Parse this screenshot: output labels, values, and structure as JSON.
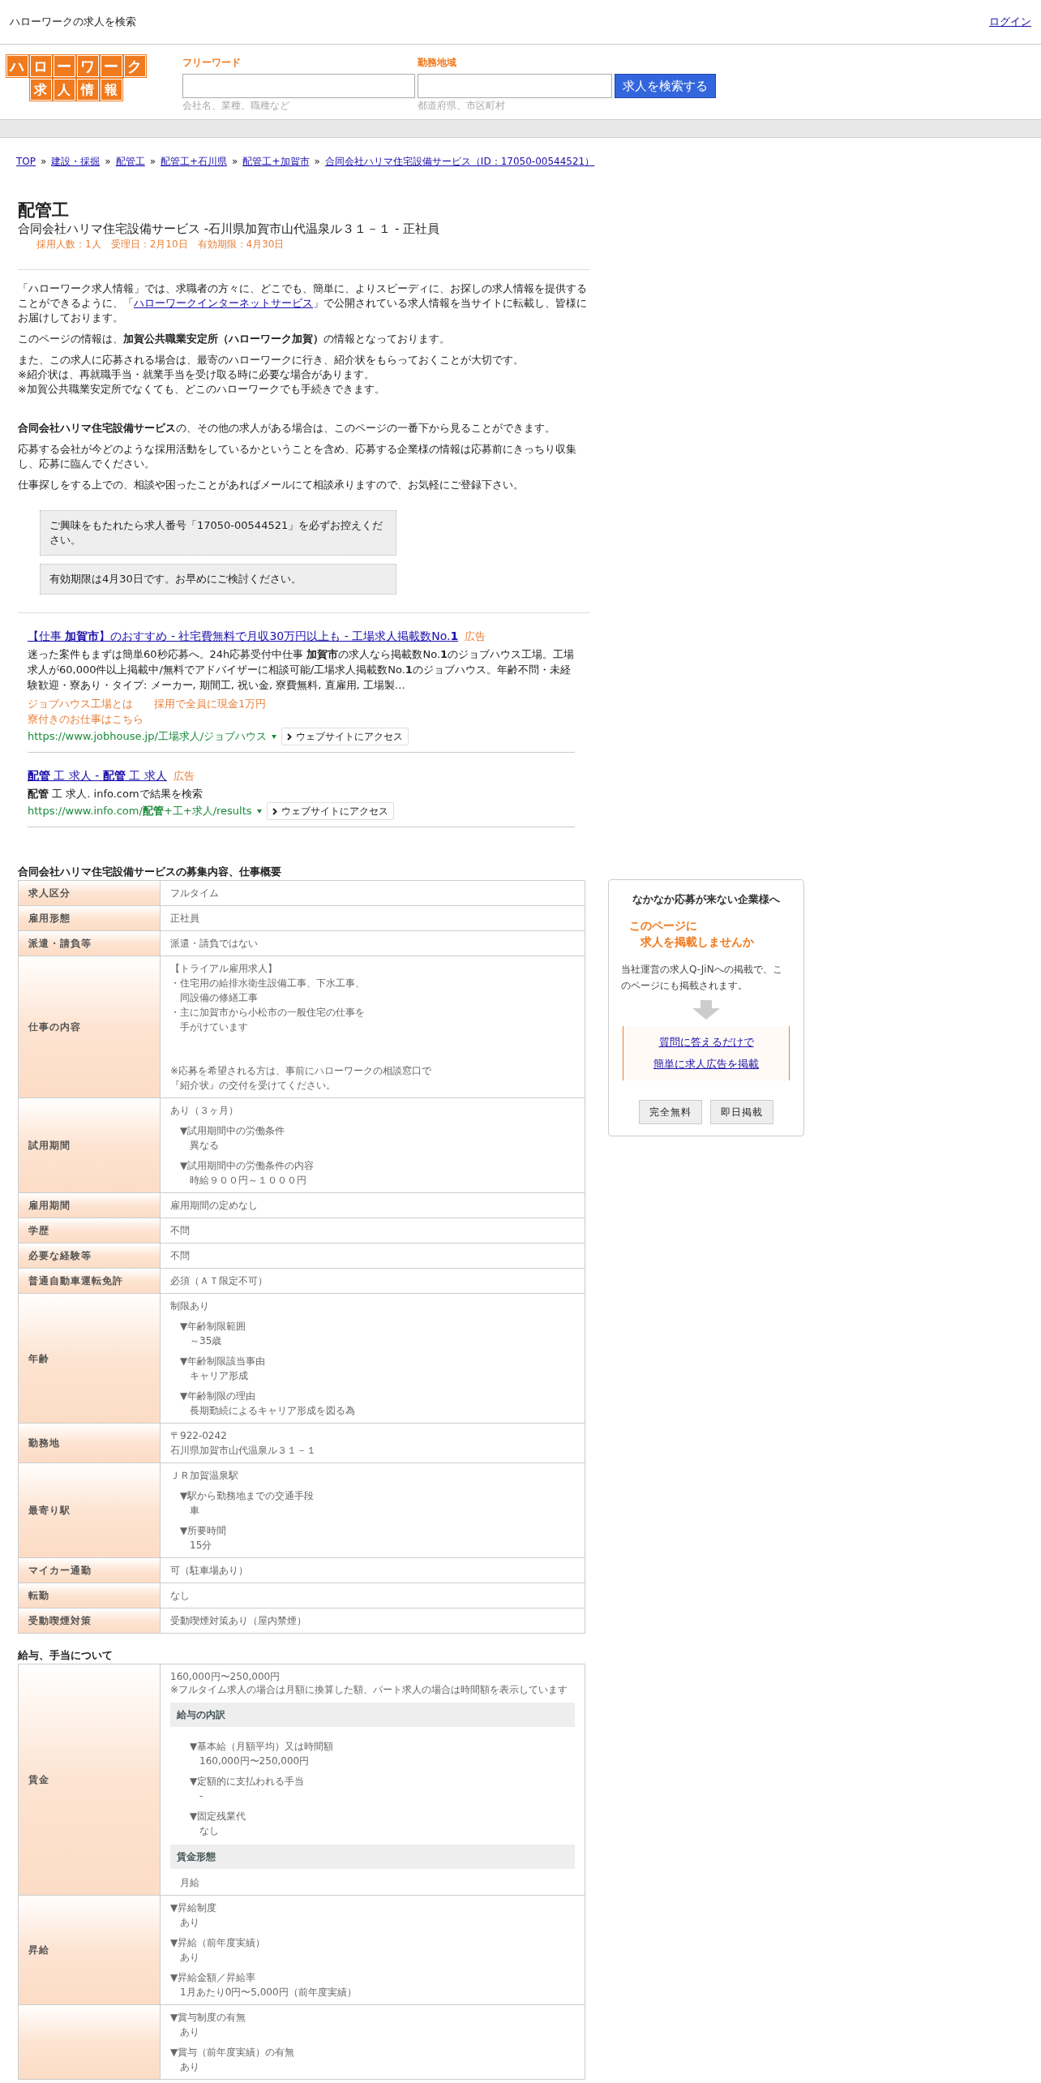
{
  "top_bar": {
    "title": "ハローワークの求人を検索",
    "login": "ログイン"
  },
  "logo": {
    "row_1": [
      "ハ",
      "ロ",
      "ー",
      "ワ",
      "ー",
      "ク"
    ],
    "row_2": [
      "求",
      "人",
      "情",
      "報"
    ]
  },
  "search": {
    "fields": [
      {
        "label": "フリーワード",
        "hint": "会社名、業種、職種など"
      },
      {
        "label": "勤務地域",
        "hint": "都道府県、市区町村"
      }
    ],
    "button": "求人を検索する"
  },
  "breadcrumb_separator": "»",
  "breadcrumb": [
    "TOP",
    "建設・採掘",
    "配管工",
    "配管工+石川県",
    "配管工+加賀市",
    "合同会社ハリマ住宅設備サービス（ID：17050-00544521）"
  ],
  "job": {
    "title": "配管工",
    "subtitle": "合同会社ハリマ住宅設備サービス -石川県加賀市山代温泉ル３１－１ - 正社員",
    "meta": "採用人数：1人　受理日：2月10日　有効期限：4月30日"
  },
  "intro": {
    "lead_before": "「ハローワーク求人情報」では、求職者の方々に、どこでも、簡単に、よりスピーディに、お探しの求人情報を提供することができるように、「",
    "lead_link": "ハローワークインターネットサービス",
    "lead_after": "」で公開されている求人情報を当サイトに転載し、皆様にお届けしております。",
    "paragraphs": [
      [
        "このページの情報は、**加賀公共職業安定所（ハローワーク加賀）**の情報となっております。"
      ],
      [
        "また、この求人に応募される場合は、最寄のハローワークに行き、紹介状をもらっておくことが大切です。",
        "※紹介状は、再就職手当・就業手当を受け取る時に必要な場合があります。",
        "※加賀公共職業安定所でなくても、どこのハローワークでも手続きできます。"
      ]
    ],
    "paragraphs_2": [
      [
        "**合同会社ハリマ住宅設備サービス**の、その他の求人がある場合は、このページの一番下から見ることができます。"
      ],
      [
        "応募する会社が今どのような採用活動をしているかということを含め、応募する企業様の情報は応募前にきっちり収集し、応募に臨んでください。"
      ],
      [
        "仕事探しをする上での、相談や困ったことがあればメールにて相談承りますので、お気軽にご登録下さい。"
      ]
    ]
  },
  "notices": [
    "ご興味をもたれたら求人番号「17050-00544521」を必ずお控えください。",
    "有効期限は4月30日です。お早めにご検討ください。"
  ],
  "ads": [
    {
      "title": "【仕事 **加賀市**】のおすすめ - 社宅費無料で月収30万円以上も - 工場求人掲載数No.**1**",
      "label": "広告",
      "description": "迷った案件もまずは簡単60秒応募へ。24h応募受付中仕事 **加賀市**の求人なら掲載数No.**1**のジョブハウス工場。工場求人が60,000件以上掲載中/無料でアドバイザーに相談可能/工場求人掲載数No.**1**のジョブハウス。年齢不問・未経験歓迎・寮あり・タイプ: メーカー, 期間工, 祝い金, 寮費無料, 直雇用, 工場製…",
      "sitelinks": [
        "ジョブハウス工場とは",
        "採用で全員に現金1万円",
        "寮付きのお仕事はこちら"
      ],
      "url": "https://www.jobhouse.jp/工場求人/ジョブハウス",
      "button": "ウェブサイトにアクセス"
    },
    {
      "title": "**配管** 工 求人 - **配管** 工 求人",
      "label": "広告",
      "description": "**配管** 工 求人. info.comで結果を検索",
      "url": "https://www.info.com/**配管**+工+求人/results",
      "button": "ウェブサイトにアクセス"
    }
  ],
  "sections": [
    {
      "title": "合同会社ハリマ住宅設備サービスの募集内容、仕事概要",
      "rows": [
        {
          "label": "求人区分",
          "content": [
            {
              "kind": "line",
              "text": "フルタイム"
            }
          ]
        },
        {
          "label": "雇用形態",
          "content": [
            {
              "kind": "line",
              "text": "正社員"
            }
          ]
        },
        {
          "label": "派遣・請負等",
          "content": [
            {
              "kind": "line",
              "text": "派遣・請負ではない"
            }
          ]
        },
        {
          "label": "仕事の内容",
          "content": [
            {
              "kind": "line",
              "text": "【トライアル雇用求人】"
            },
            {
              "kind": "line",
              "text": "・住宅用の給排水衛生設備工事、下水工事、"
            },
            {
              "kind": "line_indented",
              "text": "同設備の修繕工事"
            },
            {
              "kind": "line",
              "text": "・主に加賀市から小松市の一般住宅の仕事を"
            },
            {
              "kind": "line_indented",
              "text": "手がけています"
            },
            {
              "kind": "gap"
            },
            {
              "kind": "gap"
            },
            {
              "kind": "line",
              "text": "※応募を希望される方は、事前にハローワークの相談窓口で"
            },
            {
              "kind": "line",
              "text": "『紹介状』の交付を受けてください。"
            }
          ]
        },
        {
          "label": "試用期間",
          "content": [
            {
              "kind": "line",
              "text": "あり（３ヶ月）"
            },
            {
              "kind": "sub_indented",
              "heading": "▼試用期間中の労働条件",
              "text": "異なる"
            },
            {
              "kind": "sub_indented",
              "heading": "▼試用期間中の労働条件の内容",
              "text": "時給９００円～１０００円"
            }
          ]
        },
        {
          "label": "雇用期間",
          "content": [
            {
              "kind": "line",
              "text": "雇用期間の定めなし"
            }
          ]
        },
        {
          "label": "学歴",
          "content": [
            {
              "kind": "line",
              "text": "不問"
            }
          ]
        },
        {
          "label": "必要な経験等",
          "content": [
            {
              "kind": "line",
              "text": "不問"
            }
          ]
        },
        {
          "label": "普通自動車運転免許",
          "content": [
            {
              "kind": "line",
              "text": "必須（ＡＴ限定不可）"
            }
          ]
        },
        {
          "label": "年齢",
          "content": [
            {
              "kind": "line",
              "text": "制限あり"
            },
            {
              "kind": "sub_indented",
              "heading": "▼年齢制限範囲",
              "text": "～35歳"
            },
            {
              "kind": "sub_indented",
              "heading": "▼年齢制限該当事由",
              "text": "キャリア形成"
            },
            {
              "kind": "sub_indented",
              "heading": "▼年齢制限の理由",
              "text": "長期勤続によるキャリア形成を図る為"
            }
          ]
        },
        {
          "label": "勤務地",
          "content": [
            {
              "kind": "line",
              "text": "〒922-0242"
            },
            {
              "kind": "line",
              "text": "石川県加賀市山代温泉ル３１－１"
            }
          ]
        },
        {
          "label": "最寄り駅",
          "content": [
            {
              "kind": "line",
              "text": "ＪＲ加賀温泉駅"
            },
            {
              "kind": "sub_indented",
              "heading": "▼駅から勤務地までの交通手段",
              "text": "車"
            },
            {
              "kind": "sub_indented",
              "heading": "▼所要時間",
              "text": "15分"
            }
          ]
        },
        {
          "label": "マイカー通勤",
          "content": [
            {
              "kind": "line",
              "text": "可（駐車場あり）"
            }
          ]
        },
        {
          "label": "転勤",
          "content": [
            {
              "kind": "line",
              "text": "なし"
            }
          ]
        },
        {
          "label": "受動喫煙対策",
          "content": [
            {
              "kind": "line",
              "text": "受動喫煙対策あり（屋内禁煙）"
            }
          ]
        }
      ]
    },
    {
      "title": "給与、手当について",
      "rows": [
        {
          "label": "賃金",
          "content": [
            {
              "kind": "line",
              "text": "160,000円〜250,000円"
            },
            {
              "kind": "note",
              "text": "※フルタイム求人の場合は月額に換算した額、パート求人の場合は時間額を表示しています"
            },
            {
              "kind": "band",
              "text": "給与の内訳"
            },
            {
              "kind": "sub_deep",
              "heading": "▼基本給（月額平均）又は時間額",
              "text": "160,000円〜250,000円"
            },
            {
              "kind": "sub_deep",
              "heading": "▼定額的に支払われる手当",
              "text": "-"
            },
            {
              "kind": "sub_deep",
              "heading": "▼固定残業代",
              "text": "なし"
            },
            {
              "kind": "band",
              "text": "賃金形態"
            },
            {
              "kind": "line_indented",
              "text": "月給"
            }
          ]
        },
        {
          "label": "昇給",
          "content": [
            {
              "kind": "sub",
              "heading": "▼昇給制度",
              "text": "あり"
            },
            {
              "kind": "sub",
              "heading": "▼昇給（前年度実績）",
              "text": "あり"
            },
            {
              "kind": "sub",
              "heading": "▼昇給金額／昇給率",
              "text": "1月あたり0円〜5,000円（前年度実績）"
            }
          ]
        },
        {
          "content": [
            {
              "kind": "sub",
              "heading": "▼賞与制度の有無",
              "text": "あり"
            },
            {
              "kind": "sub",
              "heading": "▼賞与（前年度実績）の有無",
              "text": "あり"
            }
          ]
        }
      ]
    }
  ],
  "sidebar": {
    "title": "なかなか応募が来ない企業様へ",
    "catch": [
      "このページに",
      "求人を掲載しませんか"
    ],
    "body": "当社運営の求人Q-JiNへの掲載で、このページにも掲載されます。",
    "links": [
      "質問に答えるだけで",
      "簡単に求人広告を掲載"
    ],
    "badges": [
      "完全無料",
      "即日掲載"
    ]
  }
}
